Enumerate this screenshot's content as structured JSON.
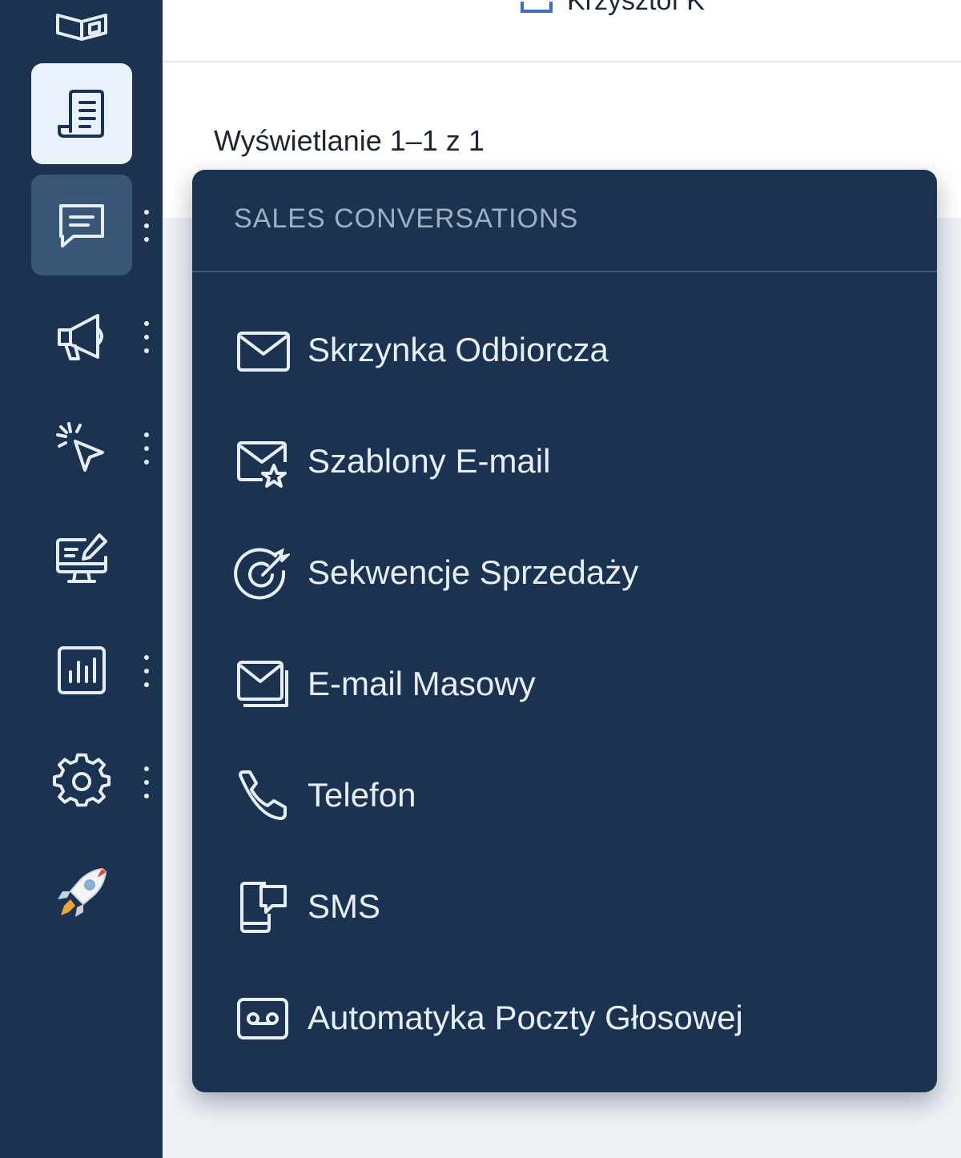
{
  "header": {
    "user_name": "Krzysztof K"
  },
  "content": {
    "showing_text": "Wyświetlanie 1–1 z 1"
  },
  "sidebar": {
    "items": [
      {
        "name": "contacts-book",
        "icon": "book-icon"
      },
      {
        "name": "documents",
        "icon": "document-icon",
        "state": "active-light"
      },
      {
        "name": "conversations",
        "icon": "chat-icon",
        "state": "active-dark",
        "has_menu": true
      },
      {
        "name": "campaigns",
        "icon": "megaphone-icon",
        "has_menu": true
      },
      {
        "name": "tracking",
        "icon": "cursor-click-icon",
        "has_menu": true
      },
      {
        "name": "landing-pages",
        "icon": "monitor-edit-icon"
      },
      {
        "name": "reports",
        "icon": "bar-chart-icon",
        "has_menu": true
      },
      {
        "name": "settings",
        "icon": "gear-icon",
        "has_menu": true
      },
      {
        "name": "getting-started",
        "icon": "rocket-icon"
      }
    ]
  },
  "menu": {
    "title": "SALES CONVERSATIONS",
    "items": [
      {
        "label": "Skrzynka Odbiorcza",
        "icon": "envelope-icon"
      },
      {
        "label": "Szablony E-mail",
        "icon": "envelope-star-icon"
      },
      {
        "label": "Sekwencje Sprzedaży",
        "icon": "target-icon"
      },
      {
        "label": "E-mail Masowy",
        "icon": "stacked-envelope-icon"
      },
      {
        "label": "Telefon",
        "icon": "phone-icon"
      },
      {
        "label": "SMS",
        "icon": "mobile-message-icon"
      },
      {
        "label": "Automatyka Poczty Głosowej",
        "icon": "voicemail-icon"
      }
    ]
  },
  "colors": {
    "sidebar_bg": "#1b3350",
    "active_light": "#e9f1fa",
    "active_dark": "#3a5676",
    "menu_text": "#e8eef5",
    "menu_header_text": "#9fb0c3"
  }
}
